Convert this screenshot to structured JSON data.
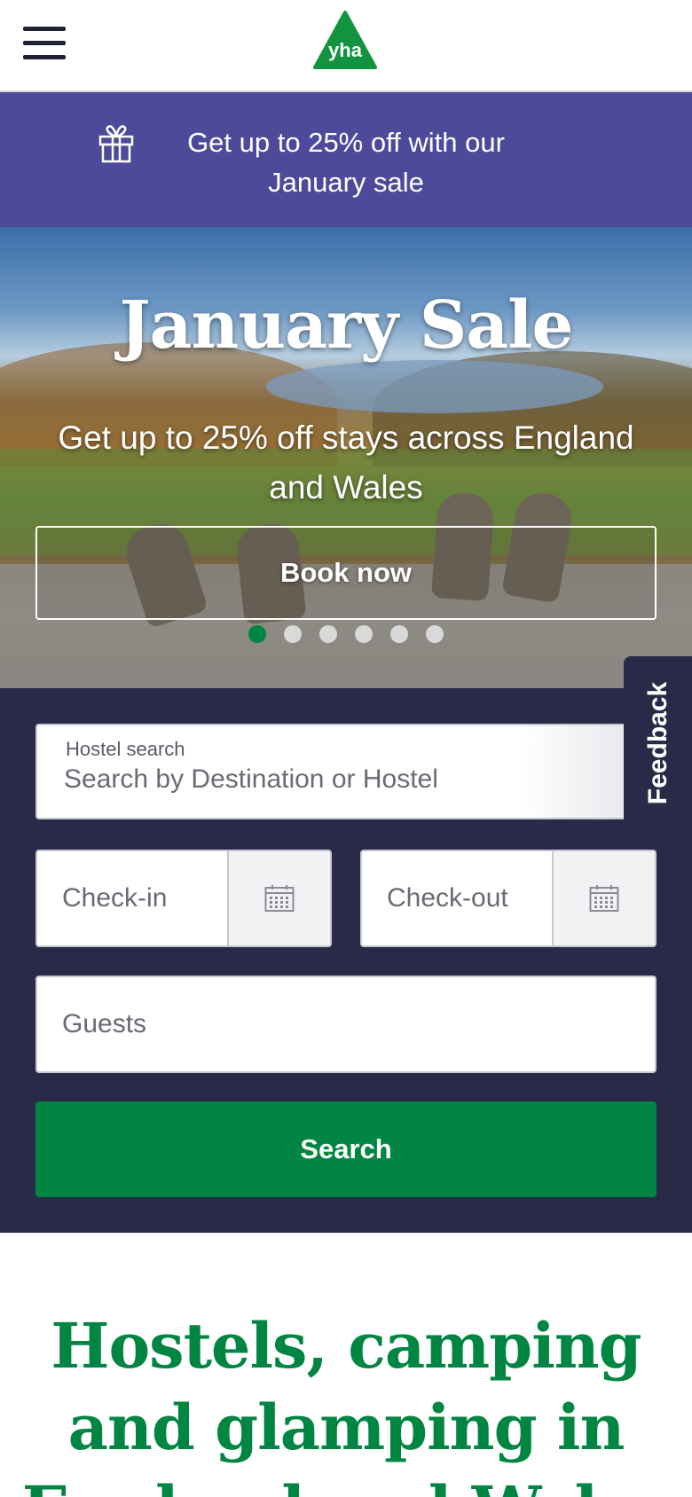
{
  "header": {
    "menu_icon": "hamburger-menu-icon",
    "logo_text": "yha",
    "logo_color": "#12933f"
  },
  "promo": {
    "icon": "gift-icon",
    "text": "Get up to 25% off with our January sale",
    "background": "#4c4a99"
  },
  "hero": {
    "title": "January Sale",
    "subtitle": "Get up to 25% off stays across England and Wales",
    "cta_label": "Book now",
    "carousel": {
      "slide_count": 6,
      "active_index": 0
    }
  },
  "search": {
    "hostel_label": "Hostel search",
    "hostel_placeholder": "Search by Destination or Hostel",
    "checkin_label": "Check-in",
    "checkout_label": "Check-out",
    "calendar_icon": "calendar-icon",
    "guests_label": "Guests",
    "submit_label": "Search",
    "panel_color": "#282a47",
    "button_color": "#008542"
  },
  "feedback": {
    "label": "Feedback"
  },
  "intro": {
    "heading": "Hostels, camping and glamping in England and Wales",
    "color": "#008542"
  }
}
